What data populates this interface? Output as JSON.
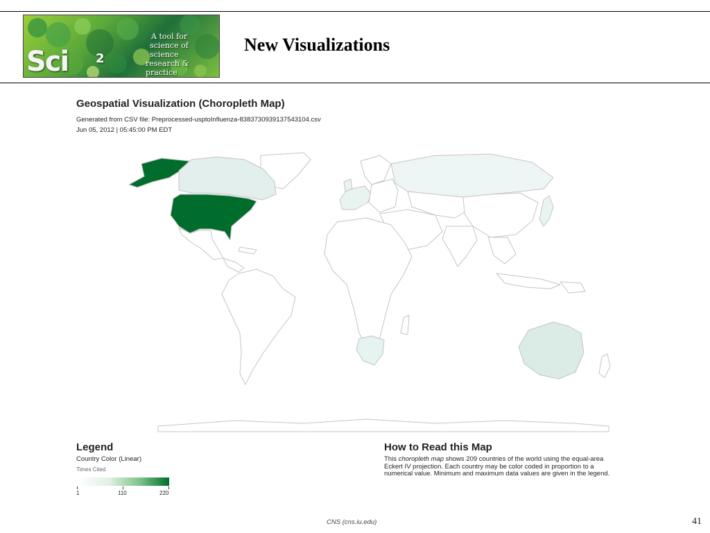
{
  "header": {
    "logo": {
      "wordmark": "Sci",
      "superscript": "2",
      "tagline_lines": [
        "A tool for",
        "science of science",
        "research & practice"
      ],
      "colors": {
        "dark": "#1f6f3a",
        "light": "#9ccf3a"
      }
    },
    "slide_title": "New Visualizations"
  },
  "visualization": {
    "title": "Geospatial Visualization (Choropleth Map)",
    "generated_from": "Generated from CSV file: Preprocessed-usptoInfluenza-8383730939137543104.csv",
    "timestamp": "Jun 05, 2012 | 05:45:00 PM EDT",
    "map": {
      "projection": "Eckert IV",
      "highlighted_countries": [
        {
          "name": "United States",
          "color": "#006d2c"
        },
        {
          "name": "Canada",
          "color": "#e3efec"
        },
        {
          "name": "Russia",
          "color": "#eef6f5"
        },
        {
          "name": "Australia",
          "color": "#dbebe6"
        },
        {
          "name": "South Africa",
          "color": "#e5f3f1"
        },
        {
          "name": "Western Europe",
          "color": "#e9f4f1"
        },
        {
          "name": "Japan",
          "color": "#e9f4f1"
        }
      ]
    }
  },
  "legend": {
    "title": "Legend",
    "subtitle": "Country Color (Linear)",
    "field": "Times Cited",
    "ticks": [
      "1",
      "110",
      "220"
    ],
    "colors": {
      "min": "#ffffff",
      "max": "#006d2c"
    }
  },
  "how_to_read": {
    "title": "How to Read this Map",
    "body_before": "This ",
    "body_em": "choropleth map",
    "body_after": " shows 209 countries of the world using the equal-area Eckert IV projection. Each country may be color coded in proportion to a numerical value. Minimum and maximum data values are given in the legend."
  },
  "footer": {
    "source": "CNS (cns.iu.edu)",
    "page_number": "41"
  }
}
